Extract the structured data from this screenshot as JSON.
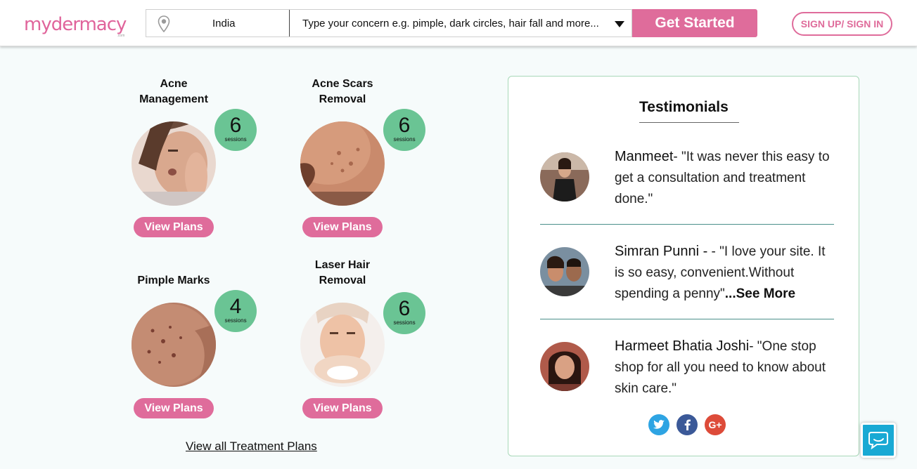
{
  "header": {
    "logo_text": "mydermacy",
    "logo_sub": ".com",
    "location": "India",
    "concern_placeholder": "Type your concern e.g. pimple, dark circles, hair fall and more...",
    "cta_label": "Get Started",
    "signin_label": "SIGN UP/ SIGN IN"
  },
  "treatments": [
    {
      "title": "Acne Management",
      "sessions": "6",
      "sessions_label": "sessions",
      "button": "View Plans"
    },
    {
      "title": "Acne Scars Removal",
      "sessions": "6",
      "sessions_label": "sessions",
      "button": "View Plans"
    },
    {
      "title": "Pimple Marks",
      "sessions": "4",
      "sessions_label": "sessions",
      "button": "View Plans"
    },
    {
      "title": "Laser Hair Removal",
      "sessions": "6",
      "sessions_label": "sessions",
      "button": "View Plans"
    }
  ],
  "view_all_label": "View all Treatment Plans",
  "testimonials": {
    "title": "Testimonials",
    "items": [
      {
        "name": "Manmeet",
        "quote": "- \"It was never this easy to get a consultation and treatment done.\"",
        "more": ""
      },
      {
        "name": "Simran Punni -",
        "quote": " - \"I love your site. It is so easy, convenient.Without spending a penny\"",
        "more": "...See More"
      },
      {
        "name": "Harmeet Bhatia Joshi",
        "quote": "- \"One stop shop for all you need to know about skin care.\"",
        "more": ""
      }
    ],
    "social": [
      "twitter-icon",
      "facebook-icon",
      "google-plus-icon"
    ]
  },
  "colors": {
    "brand_pink": "#df6c9b",
    "badge_green": "#6ac494",
    "chat_blue": "#19a9d4"
  }
}
